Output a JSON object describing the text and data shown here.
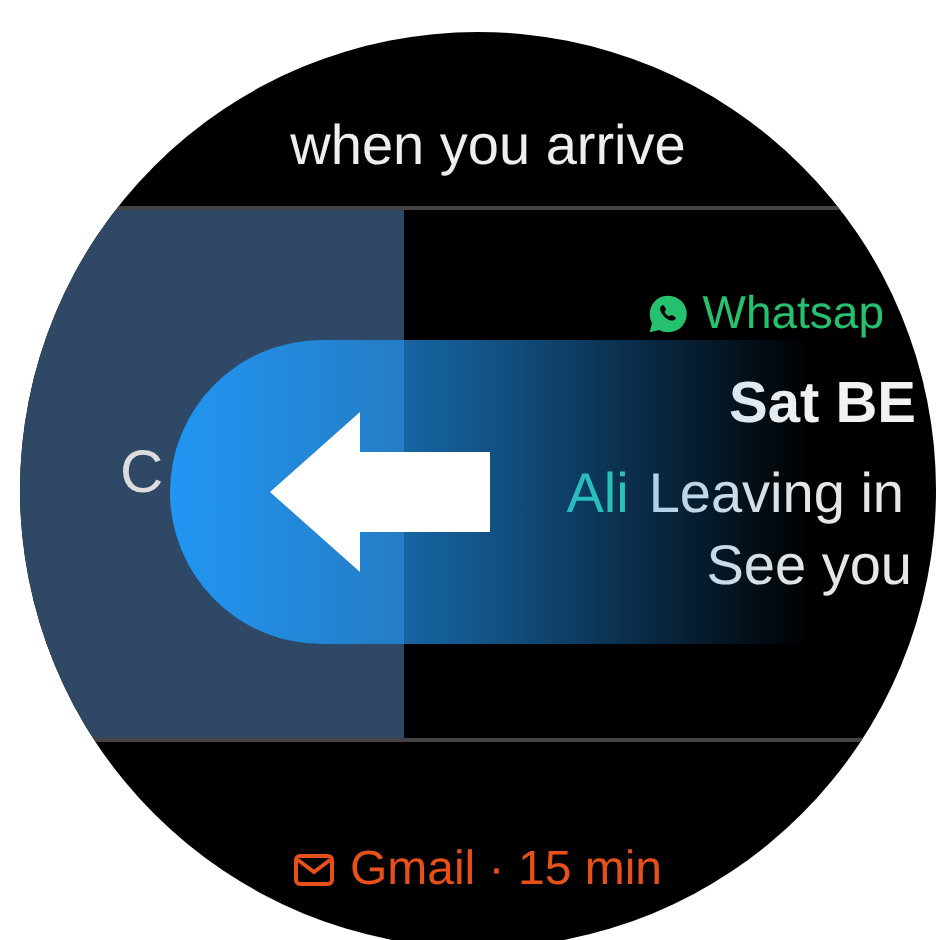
{
  "previous_message": {
    "last_line": "when you arrive"
  },
  "notification": {
    "swipe_action": "C",
    "app": "Whatsap",
    "title": "Sat BE",
    "sender": "Ali",
    "lines": [
      "Leaving in",
      "See you"
    ]
  },
  "next_notification": {
    "header": "Gmail · 15 min"
  }
}
